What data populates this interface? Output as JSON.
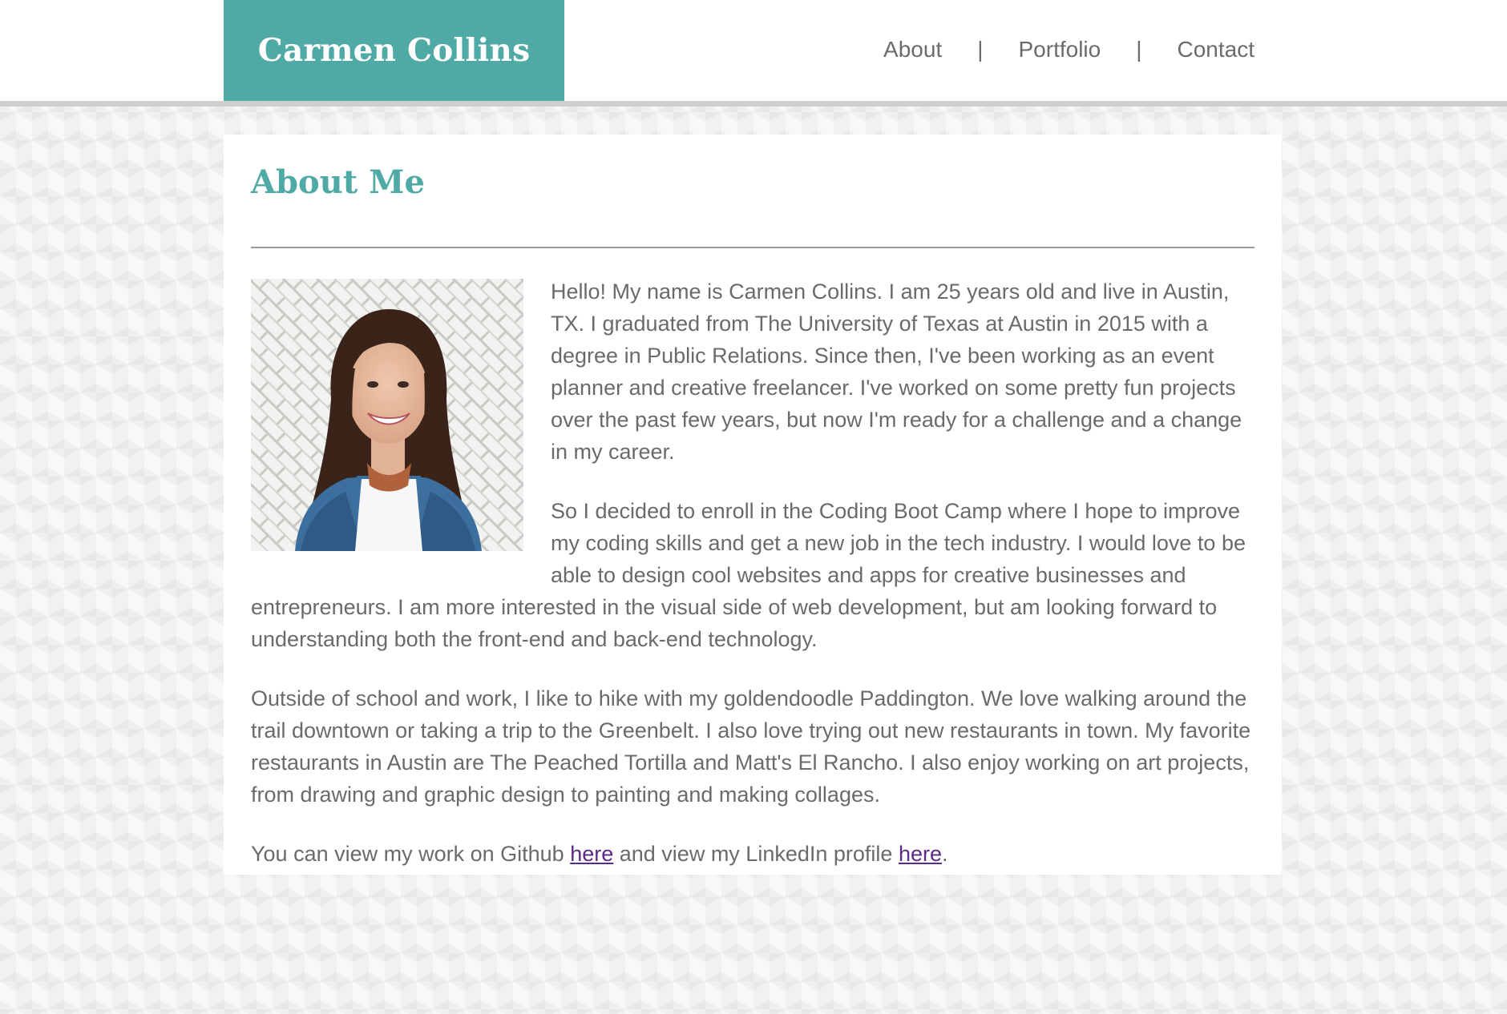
{
  "header": {
    "brand": "Carmen Collins",
    "nav": {
      "about": "About",
      "portfolio": "Portfolio",
      "contact": "Contact",
      "separator": "|"
    }
  },
  "main": {
    "title": "About Me",
    "photo_alt": "Portrait of Carmen Collins",
    "paragraphs": [
      "Hello! My name is Carmen Collins. I am 25 years old and live in Austin, TX. I graduated from The University of Texas at Austin in 2015 with a degree in Public Relations. Since then, I've been working as an event planner and creative freelancer. I've worked on some pretty fun projects over the past few years, but now I'm ready for a challenge and a change in my career.",
      "So I decided to enroll in the Coding Boot Camp where I hope to improve my coding skills and get a new job in the tech industry. I would love to be able to design cool websites and apps for creative businesses and entrepreneurs. I am more interested in the visual side of web development, but am looking forward to understanding both the front-end and back-end technology.",
      "Outside of school and work, I like to hike with my goldendoodle Paddington. We love walking around the trail downtown or taking a trip to the Greenbelt. I also love trying out new restaurants in town. My favorite restaurants in Austin are The Peached Tortilla and Matt's El Rancho. I also enjoy working on art projects, from drawing and graphic design to painting and making collages."
    ],
    "links_paragraph": {
      "text_1": "You can view my work on Github ",
      "link_1": "here",
      "text_2": " and view my LinkedIn profile ",
      "link_2": "here",
      "text_3": "."
    }
  },
  "colors": {
    "accent": "#4fa9a4",
    "text": "#6a6a6a",
    "link": "#5a2a8a"
  }
}
